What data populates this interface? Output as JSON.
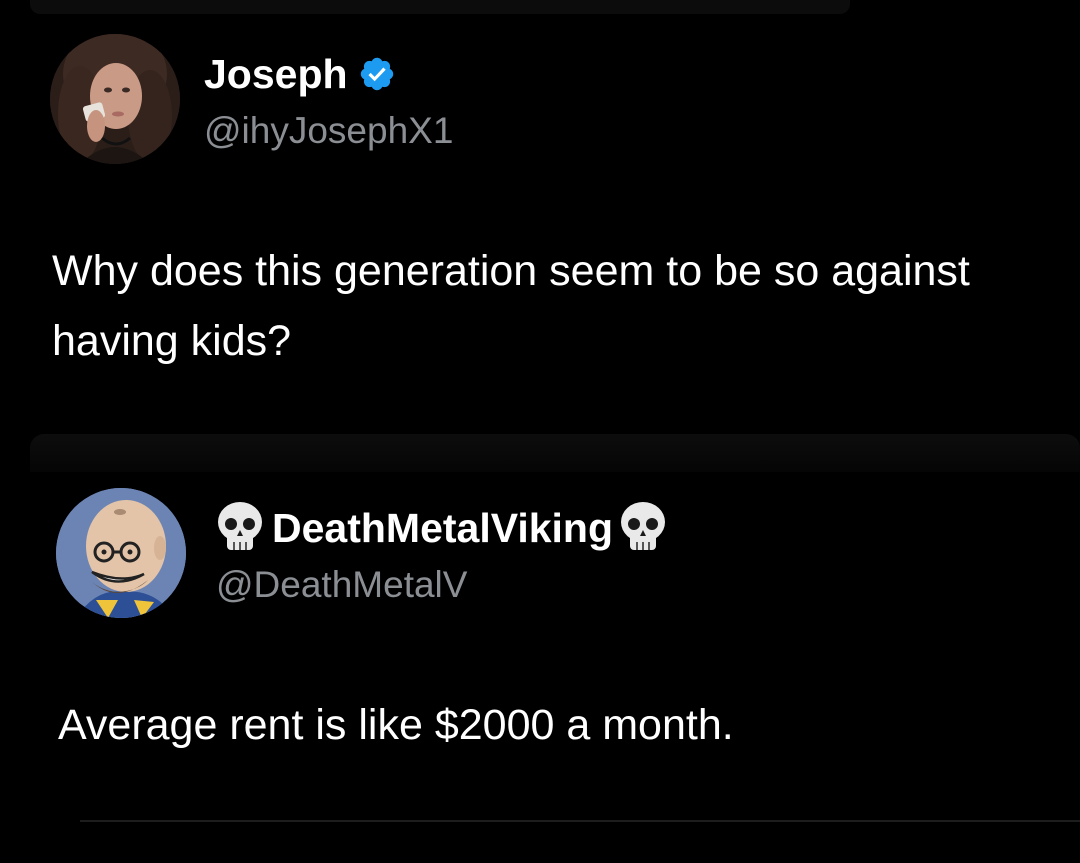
{
  "tweets": [
    {
      "display_name": "Joseph",
      "handle": "@ihyJosephX1",
      "verified": true,
      "text": "Why does this generation seem to be so against having kids?",
      "avatar": "woman-crying-photo-avatar"
    },
    {
      "display_name": "DeathMetalViking",
      "name_prefix_emoji": "skull-icon",
      "name_suffix_emoji": "skull-icon",
      "handle": "@DeathMetalV",
      "verified": false,
      "text": "Average rent is like $2000 a month.",
      "avatar": "cartoon-bald-man-avatar"
    }
  ],
  "colors": {
    "background": "#000000",
    "name": "#ffffff",
    "handle": "#8b8f94",
    "verified_badge": "#1d9bf0"
  }
}
